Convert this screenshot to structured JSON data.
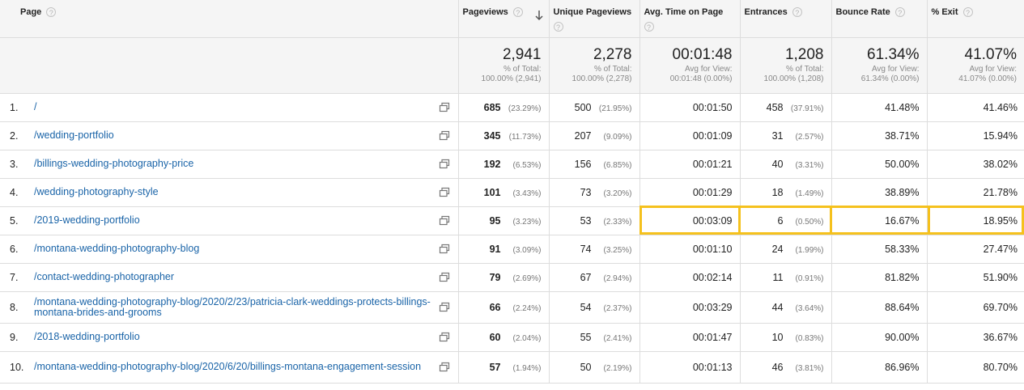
{
  "header": {
    "page": "Page",
    "pageviews": "Pageviews",
    "unique_pageviews": "Unique Pageviews",
    "avg_time": "Avg. Time on Page",
    "entrances": "Entrances",
    "bounce_rate": "Bounce Rate",
    "exit": "% Exit",
    "help_glyph": "?"
  },
  "totals": {
    "pageviews": {
      "value": "2,941",
      "sub1": "% of Total:",
      "sub2": "100.00% (2,941)"
    },
    "unique": {
      "value": "2,278",
      "sub1": "% of Total:",
      "sub2": "100.00% (2,278)"
    },
    "avg_time": {
      "value": "00:01:48",
      "sub1": "Avg for View:",
      "sub2": "00:01:48 (0.00%)"
    },
    "entrances": {
      "value": "1,208",
      "sub1": "% of Total:",
      "sub2": "100.00% (1,208)"
    },
    "bounce": {
      "value": "61.34%",
      "sub1": "Avg for View:",
      "sub2": "61.34% (0.00%)"
    },
    "exit": {
      "value": "41.07%",
      "sub1": "Avg for View:",
      "sub2": "41.07% (0.00%)"
    }
  },
  "rows": [
    {
      "n": "1.",
      "page": "/",
      "pv": "685",
      "pv_pct": "(23.29%)",
      "upv": "500",
      "upv_pct": "(21.95%)",
      "avg": "00:01:50",
      "ent": "458",
      "ent_pct": "(37.91%)",
      "br": "41.48%",
      "exit": "41.46%"
    },
    {
      "n": "2.",
      "page": "/wedding-portfolio",
      "pv": "345",
      "pv_pct": "(11.73%)",
      "upv": "207",
      "upv_pct": "(9.09%)",
      "avg": "00:01:09",
      "ent": "31",
      "ent_pct": "(2.57%)",
      "br": "38.71%",
      "exit": "15.94%"
    },
    {
      "n": "3.",
      "page": "/billings-wedding-photography-price",
      "pv": "192",
      "pv_pct": "(6.53%)",
      "upv": "156",
      "upv_pct": "(6.85%)",
      "avg": "00:01:21",
      "ent": "40",
      "ent_pct": "(3.31%)",
      "br": "50.00%",
      "exit": "38.02%"
    },
    {
      "n": "4.",
      "page": "/wedding-photography-style",
      "pv": "101",
      "pv_pct": "(3.43%)",
      "upv": "73",
      "upv_pct": "(3.20%)",
      "avg": "00:01:29",
      "ent": "18",
      "ent_pct": "(1.49%)",
      "br": "38.89%",
      "exit": "21.78%"
    },
    {
      "n": "5.",
      "page": "/2019-wedding-portfolio",
      "pv": "95",
      "pv_pct": "(3.23%)",
      "upv": "53",
      "upv_pct": "(2.33%)",
      "avg": "00:03:09",
      "ent": "6",
      "ent_pct": "(0.50%)",
      "br": "16.67%",
      "exit": "18.95%"
    },
    {
      "n": "6.",
      "page": "/montana-wedding-photography-blog",
      "pv": "91",
      "pv_pct": "(3.09%)",
      "upv": "74",
      "upv_pct": "(3.25%)",
      "avg": "00:01:10",
      "ent": "24",
      "ent_pct": "(1.99%)",
      "br": "58.33%",
      "exit": "27.47%"
    },
    {
      "n": "7.",
      "page": "/contact-wedding-photographer",
      "pv": "79",
      "pv_pct": "(2.69%)",
      "upv": "67",
      "upv_pct": "(2.94%)",
      "avg": "00:02:14",
      "ent": "11",
      "ent_pct": "(0.91%)",
      "br": "81.82%",
      "exit": "51.90%"
    },
    {
      "n": "8.",
      "page": "/montana-wedding-photography-blog/2020/2/23/patricia-clark-weddings-protects-billings-montana-brides-and-grooms",
      "pv": "66",
      "pv_pct": "(2.24%)",
      "upv": "54",
      "upv_pct": "(2.37%)",
      "avg": "00:03:29",
      "ent": "44",
      "ent_pct": "(3.64%)",
      "br": "88.64%",
      "exit": "69.70%"
    },
    {
      "n": "9.",
      "page": "/2018-wedding-portfolio",
      "pv": "60",
      "pv_pct": "(2.04%)",
      "upv": "55",
      "upv_pct": "(2.41%)",
      "avg": "00:01:47",
      "ent": "10",
      "ent_pct": "(0.83%)",
      "br": "90.00%",
      "exit": "36.67%"
    },
    {
      "n": "10.",
      "page": "/montana-wedding-photography-blog/2020/6/20/billings-montana-engagement-session",
      "pv": "57",
      "pv_pct": "(1.94%)",
      "upv": "50",
      "upv_pct": "(2.19%)",
      "avg": "00:01:13",
      "ent": "46",
      "ent_pct": "(3.81%)",
      "br": "86.96%",
      "exit": "80.70%"
    }
  ],
  "colors": {
    "link": "#1a64a8",
    "highlight": "#f5c11d",
    "header_bg": "#f5f5f5"
  },
  "icons": {
    "help": "help-circle-icon",
    "sort": "sort-descending-arrow-icon",
    "open_external": "open-in-new-window-icon"
  }
}
